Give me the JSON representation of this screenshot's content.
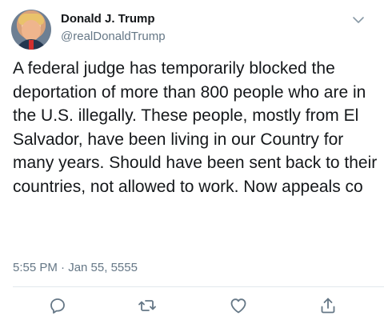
{
  "tweet": {
    "author_name": "Donald J. Trump",
    "author_handle": "@realDonaldTrump",
    "text": "A federal judge has temporarily blocked the deportation of more than 800 people who are in the U.S. illegally. These people, mostly from El Salvador, have been living in our Country for many years. Should have been sent back to their countries, not allowed to work. Now appeals co",
    "timestamp": "5:55 PM · Jan 55, 5555"
  },
  "icons": {
    "menu": "chevron-down-icon",
    "reply": "reply-icon",
    "retweet": "retweet-icon",
    "like": "heart-icon",
    "share": "share-icon"
  },
  "colors": {
    "text": "#14171a",
    "secondary": "#657786",
    "divider": "#e1e8ed"
  }
}
